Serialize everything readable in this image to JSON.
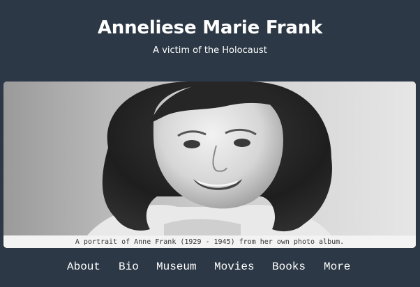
{
  "header": {
    "title": "Anneliese Marie Frank",
    "subtitle": "A victim of the Holocaust"
  },
  "figure": {
    "image_subject": "portrait-photo",
    "caption": "A portrait of Anne Frank (1929 - 1945) from her own photo album."
  },
  "nav": {
    "items": [
      {
        "label": "About"
      },
      {
        "label": "Bio"
      },
      {
        "label": "Museum"
      },
      {
        "label": "Movies"
      },
      {
        "label": "Books"
      },
      {
        "label": "More"
      }
    ]
  },
  "colors": {
    "background": "#2c3845",
    "text": "#ffffff",
    "figure_bg": "#f0f0f0",
    "caption_text": "#333333"
  }
}
